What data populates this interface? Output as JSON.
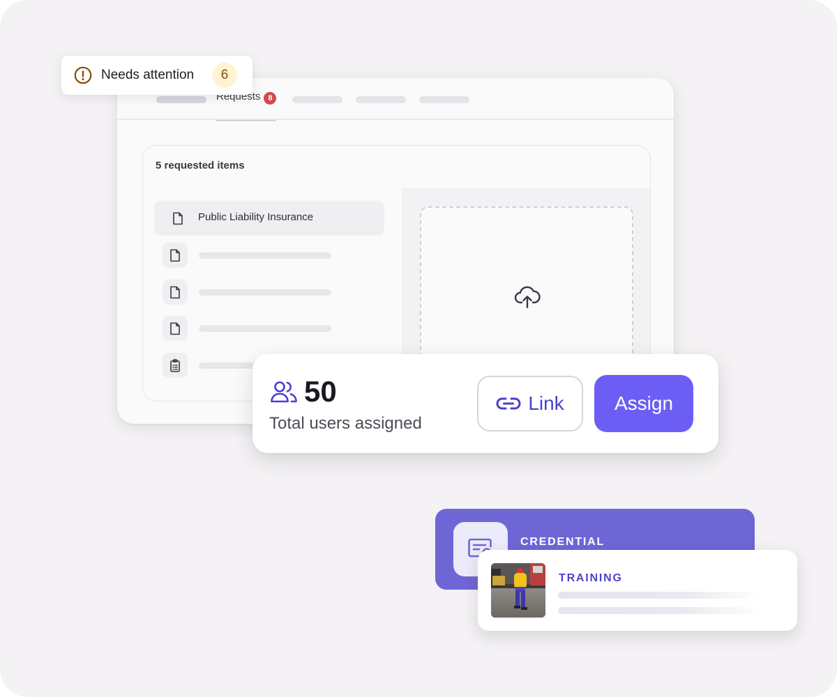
{
  "tabs": {
    "requests_label": "Requests",
    "requests_badge": "8"
  },
  "attention": {
    "label": "Needs attention",
    "count": "6",
    "icon": "alert-circle-icon"
  },
  "panel": {
    "title": "5 requested items",
    "items": [
      {
        "label": "Public Liability Insurance",
        "icon": "file-icon",
        "selected": true
      },
      {
        "label": "",
        "icon": "file-icon"
      },
      {
        "label": "",
        "icon": "file-icon"
      },
      {
        "label": "",
        "icon": "file-icon"
      },
      {
        "label": "",
        "icon": "clipboard-icon"
      }
    ],
    "upload_icon": "cloud-upload-icon"
  },
  "users": {
    "count": "50",
    "label": "Total users assigned",
    "icon": "users-icon",
    "link_label": "Link",
    "assign_label": "Assign"
  },
  "credential": {
    "label": "CREDENTIAL",
    "icon": "certificate-icon"
  },
  "training": {
    "label": "TRAINING",
    "image": "worker-photo"
  },
  "colors": {
    "accent": "#6c5ef4",
    "credential_bg": "#6f66d6",
    "badge_red": "#d24a4a",
    "attention_badge_bg": "#fff3d4",
    "attention_badge_text": "#8a4a08",
    "background": "#f4f2f4"
  }
}
